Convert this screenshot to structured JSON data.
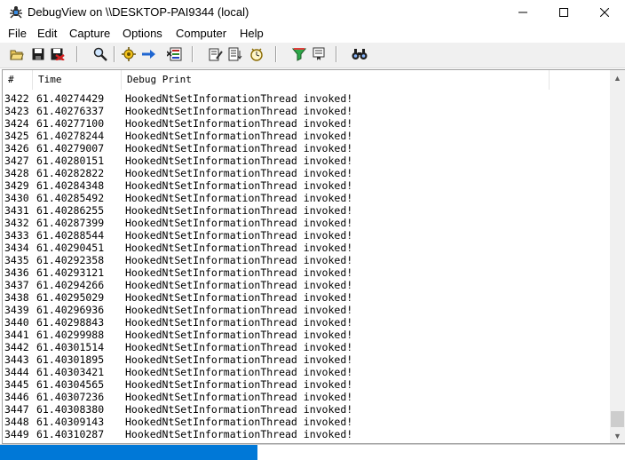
{
  "window": {
    "title": "DebugView on \\\\DESKTOP-PAI9344 (local)"
  },
  "menu": [
    "File",
    "Edit",
    "Capture",
    "Options",
    "Computer",
    "Help"
  ],
  "toolbar_icons": [
    "open-folder-icon",
    "save-icon",
    "log-to-file-icon",
    "find-icon",
    "capture-icon",
    "autoscroll-icon",
    "clear-display-icon",
    "edit-filter-icon",
    "history-depth-icon",
    "clock-time-icon",
    "highlight-filter-icon",
    "bookmark-icon",
    "find-next-icon"
  ],
  "columns": {
    "num": "#",
    "time": "Time",
    "msg": "Debug Print"
  },
  "rows": [
    {
      "num": "3422",
      "time": "61.40274429",
      "msg": "HookedNtSetInformationThread invoked!"
    },
    {
      "num": "3423",
      "time": "61.40276337",
      "msg": "HookedNtSetInformationThread invoked!"
    },
    {
      "num": "3424",
      "time": "61.40277100",
      "msg": "HookedNtSetInformationThread invoked!"
    },
    {
      "num": "3425",
      "time": "61.40278244",
      "msg": "HookedNtSetInformationThread invoked!"
    },
    {
      "num": "3426",
      "time": "61.40279007",
      "msg": "HookedNtSetInformationThread invoked!"
    },
    {
      "num": "3427",
      "time": "61.40280151",
      "msg": "HookedNtSetInformationThread invoked!"
    },
    {
      "num": "3428",
      "time": "61.40282822",
      "msg": "HookedNtSetInformationThread invoked!"
    },
    {
      "num": "3429",
      "time": "61.40284348",
      "msg": "HookedNtSetInformationThread invoked!"
    },
    {
      "num": "3430",
      "time": "61.40285492",
      "msg": "HookedNtSetInformationThread invoked!"
    },
    {
      "num": "3431",
      "time": "61.40286255",
      "msg": "HookedNtSetInformationThread invoked!"
    },
    {
      "num": "3432",
      "time": "61.40287399",
      "msg": "HookedNtSetInformationThread invoked!"
    },
    {
      "num": "3433",
      "time": "61.40288544",
      "msg": "HookedNtSetInformationThread invoked!"
    },
    {
      "num": "3434",
      "time": "61.40290451",
      "msg": "HookedNtSetInformationThread invoked!"
    },
    {
      "num": "3435",
      "time": "61.40292358",
      "msg": "HookedNtSetInformationThread invoked!"
    },
    {
      "num": "3436",
      "time": "61.40293121",
      "msg": "HookedNtSetInformationThread invoked!"
    },
    {
      "num": "3437",
      "time": "61.40294266",
      "msg": "HookedNtSetInformationThread invoked!"
    },
    {
      "num": "3438",
      "time": "61.40295029",
      "msg": "HookedNtSetInformationThread invoked!"
    },
    {
      "num": "3439",
      "time": "61.40296936",
      "msg": "HookedNtSetInformationThread invoked!"
    },
    {
      "num": "3440",
      "time": "61.40298843",
      "msg": "HookedNtSetInformationThread invoked!"
    },
    {
      "num": "3441",
      "time": "61.40299988",
      "msg": "HookedNtSetInformationThread invoked!"
    },
    {
      "num": "3442",
      "time": "61.40301514",
      "msg": "HookedNtSetInformationThread invoked!"
    },
    {
      "num": "3443",
      "time": "61.40301895",
      "msg": "HookedNtSetInformationThread invoked!"
    },
    {
      "num": "3444",
      "time": "61.40303421",
      "msg": "HookedNtSetInformationThread invoked!"
    },
    {
      "num": "3445",
      "time": "61.40304565",
      "msg": "HookedNtSetInformationThread invoked!"
    },
    {
      "num": "3446",
      "time": "61.40307236",
      "msg": "HookedNtSetInformationThread invoked!"
    },
    {
      "num": "3447",
      "time": "61.40308380",
      "msg": "HookedNtSetInformationThread invoked!"
    },
    {
      "num": "3448",
      "time": "61.40309143",
      "msg": "HookedNtSetInformationThread invoked!"
    },
    {
      "num": "3449",
      "time": "61.40310287",
      "msg": "HookedNtSetInformationThread invoked!"
    }
  ],
  "scroll_position": 0.97,
  "colors": {
    "desktop": "#0078d7",
    "text": "#000000"
  }
}
